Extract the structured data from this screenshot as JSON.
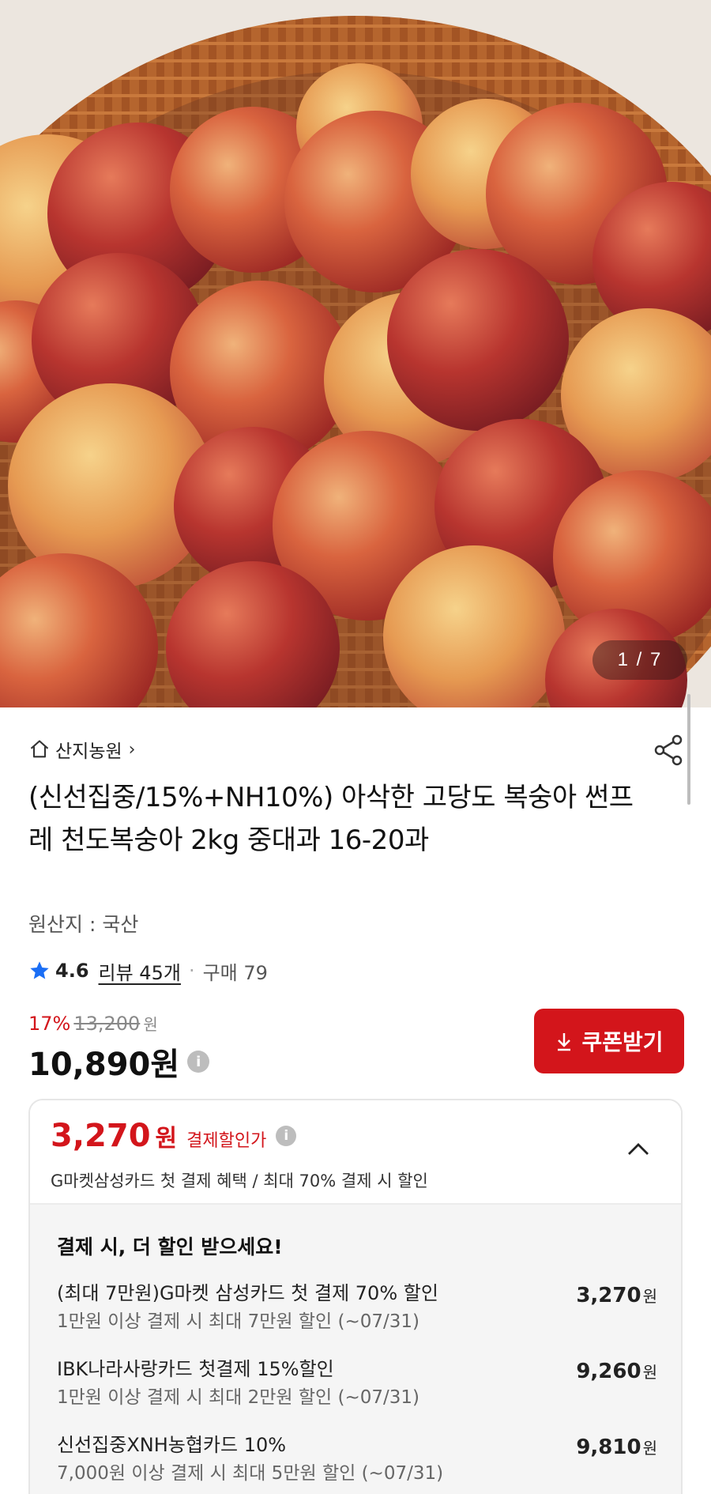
{
  "gallery": {
    "counter": "1 / 7"
  },
  "store": {
    "name": "산지농원",
    "chevron": "›"
  },
  "product": {
    "title": "(신선집중/15%+NH10%) 아삭한 고당도 복숭아 썬프레 천도복숭아 2kg 중대과 16-20과",
    "origin": "원산지 : 국산"
  },
  "rating": {
    "score": "4.6",
    "review": "리뷰 45개",
    "dot": "·",
    "purchases": "구매 79"
  },
  "price": {
    "discount_pct": "17%",
    "original": "13,200",
    "original_unit": "원",
    "final": "10,890원",
    "info_icon": "i"
  },
  "coupon": {
    "label": "쿠폰받기"
  },
  "card_benefit": {
    "amount": "3,270",
    "unit": "원",
    "label": "결제할인가",
    "info_icon": "i",
    "subtitle": "G마켓삼성카드 첫 결제 혜택 / 최대 70% 결제 시 할인",
    "heading": "결제 시, 더 할인 받으세요!",
    "offers": [
      {
        "name": "(최대 7만원)G마켓 삼성카드 첫 결제 70% 할인",
        "condition": "1만원 이상 결제 시 최대 7만원 할인 (~07/31)",
        "value": "3,270",
        "unit": "원"
      },
      {
        "name": "IBK나라사랑카드 첫결제 15%할인",
        "condition": "1만원 이상 결제 시 최대 2만원 할인 (~07/31)",
        "value": "9,260",
        "unit": "원"
      },
      {
        "name": "신선집중XNH농협카드 10%",
        "condition": "7,000원 이상 결제 시 최대 5만원 할인 (~07/31)",
        "value": "9,810",
        "unit": "원"
      }
    ]
  },
  "colors": {
    "accent": "#d3151b",
    "muted": "#888888",
    "panel": "#f5f5f5"
  },
  "icons": [
    "home-icon",
    "share-icon",
    "star-icon",
    "info-icon",
    "download-icon",
    "chevron-up-icon"
  ]
}
